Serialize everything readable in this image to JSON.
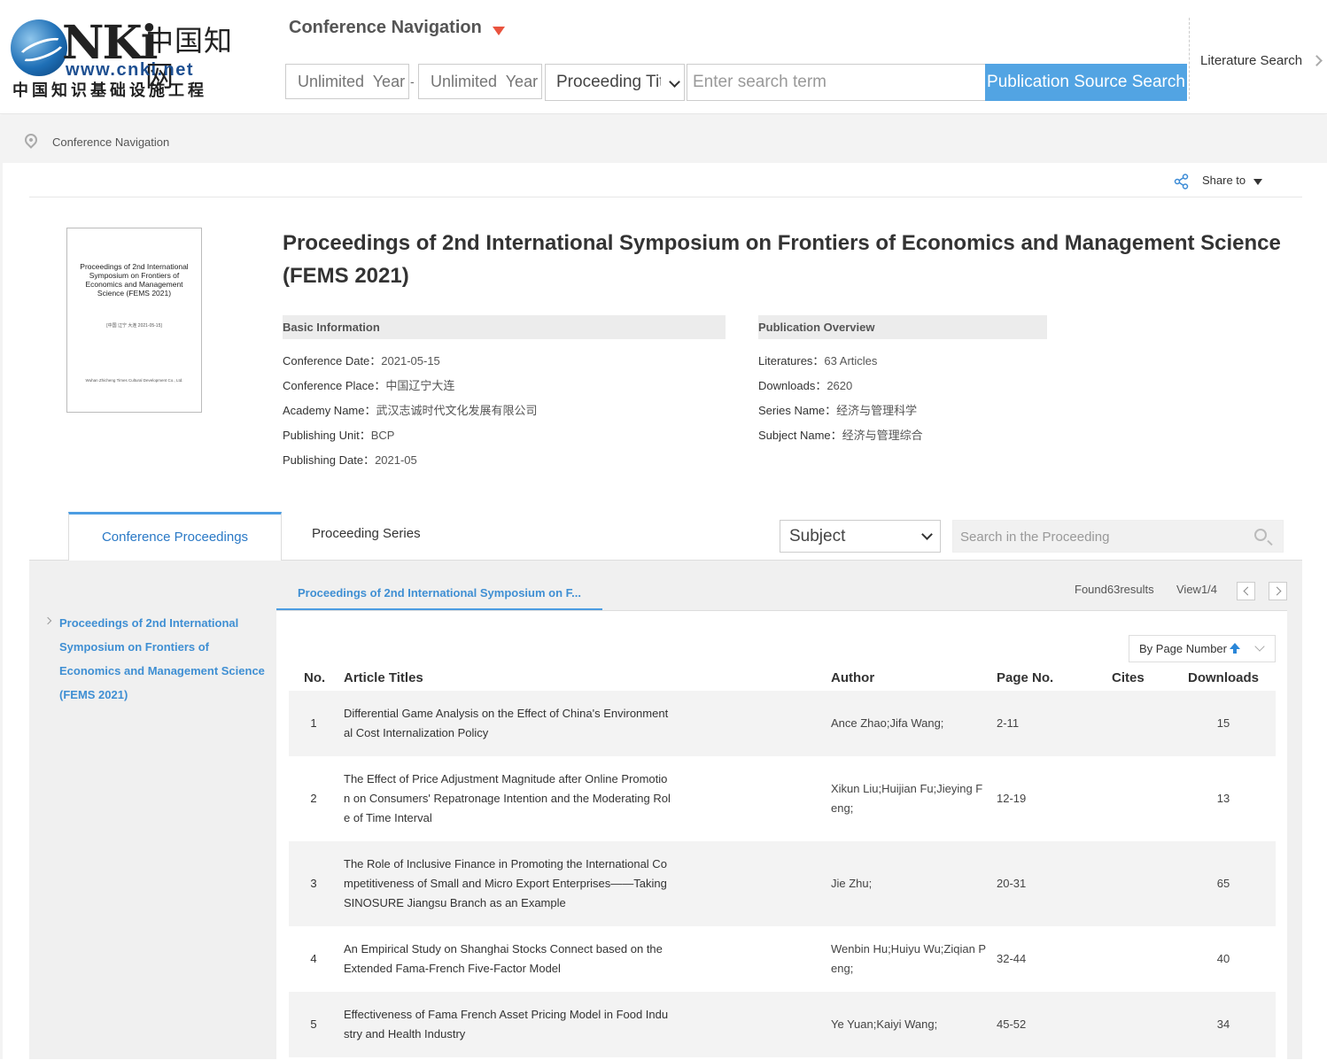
{
  "header": {
    "logo": {
      "brand": "CNKI",
      "brand_text": "NKi",
      "cn_name": "中国知网",
      "url": "www.cnki.net",
      "cn_subtitle": "中国知识基础设施工程"
    },
    "conference_nav_label": "Conference Navigation",
    "year_from_placeholder": "Unlimited  Year",
    "year_separator": "-",
    "year_to_placeholder": "Unlimited  Year",
    "search_type": "Proceeding Tit",
    "search_placeholder": "Enter search term",
    "search_button": "Publication Source Search",
    "literature_search": "Literature Search"
  },
  "breadcrumb": {
    "items": [
      "Conference Navigation"
    ]
  },
  "share": {
    "label": "Share to"
  },
  "cover": {
    "title": "Proceedings of 2nd International Symposium on Frontiers of Economics and Management Science (FEMS 2021)",
    "meta": "[中国  辽宁  大连    2021-05-15]",
    "publisher": "Wuhan Zhicheng Times Cultural Development Co., Ltd."
  },
  "proceeding": {
    "title": "Proceedings of 2nd International Symposium on Frontiers of Economics and Management Science (FEMS 2021)",
    "basic_info": {
      "heading": "Basic Information",
      "rows": [
        {
          "label": "Conference Date：",
          "value": "2021-05-15"
        },
        {
          "label": "Conference Place：",
          "value": "中国辽宁大连"
        },
        {
          "label": "Academy Name：",
          "value": "武汉志诚时代文化发展有限公司"
        },
        {
          "label": "Publishing Unit：",
          "value": "BCP"
        },
        {
          "label": "Publishing Date：",
          "value": "2021-05"
        }
      ]
    },
    "overview": {
      "heading": "Publication Overview",
      "rows": [
        {
          "label": "Literatures：",
          "value": "63 Articles"
        },
        {
          "label": "Downloads：",
          "value": "2620"
        },
        {
          "label": "Series Name：",
          "value": "经济与管理科学"
        },
        {
          "label": "Subject Name：",
          "value": "经济与管理综合"
        }
      ]
    }
  },
  "tabs": [
    {
      "label": "Conference Proceedings",
      "active": true
    },
    {
      "label": "Proceeding Series",
      "active": false
    }
  ],
  "filter": {
    "subject_select": "Subject",
    "search_placeholder": "Search in the Proceeding"
  },
  "sidebar": {
    "items": [
      {
        "label": "Proceedings of 2nd International Symposium on Frontiers of Economics and Management Science (FEMS 2021)"
      }
    ]
  },
  "results": {
    "subtab": "Proceedings of 2nd International Symposium on F...",
    "found": "Found63results",
    "view": "View1/4",
    "sort": "By Page Number",
    "columns": [
      "No.",
      "Article Titles",
      "Author",
      "Page No.",
      "Cites",
      "Downloads"
    ],
    "rows": [
      {
        "no": "1",
        "title": "Differential Game Analysis on the Effect of China's Environmental Cost Internalization Policy",
        "author": "Ance Zhao;Jifa Wang;",
        "page": "2-11",
        "cites": "",
        "downloads": "15"
      },
      {
        "no": "2",
        "title": "The Effect of Price Adjustment Magnitude after Online Promotion on Consumers' Repatronage Intention and the Moderating Role of Time Interval",
        "author": "Xikun Liu;Huijian Fu;Jieying Feng;",
        "page": "12-19",
        "cites": "",
        "downloads": "13"
      },
      {
        "no": "3",
        "title": "The Role of Inclusive Finance in Promoting the International Competitiveness of Small and Micro Export Enterprises——Taking SINOSURE Jiangsu Branch as an Example",
        "author": "Jie Zhu;",
        "page": "20-31",
        "cites": "",
        "downloads": "65"
      },
      {
        "no": "4",
        "title": "An Empirical Study on Shanghai Stocks Connect based on the Extended Fama-French Five-Factor Model",
        "author": "Wenbin Hu;Huiyu Wu;Ziqian Peng;",
        "page": "32-44",
        "cites": "",
        "downloads": "40"
      },
      {
        "no": "5",
        "title": "Effectiveness of Fama French Asset Pricing Model in Food Industry and Health Industry",
        "author": "Ye Yuan;Kaiyi Wang;",
        "page": "45-52",
        "cites": "",
        "downloads": "34"
      }
    ]
  },
  "colors": {
    "accent_blue": "#52a4e3",
    "link_blue": "#3f8fd3",
    "nav_arrow_red": "#e9533e"
  }
}
